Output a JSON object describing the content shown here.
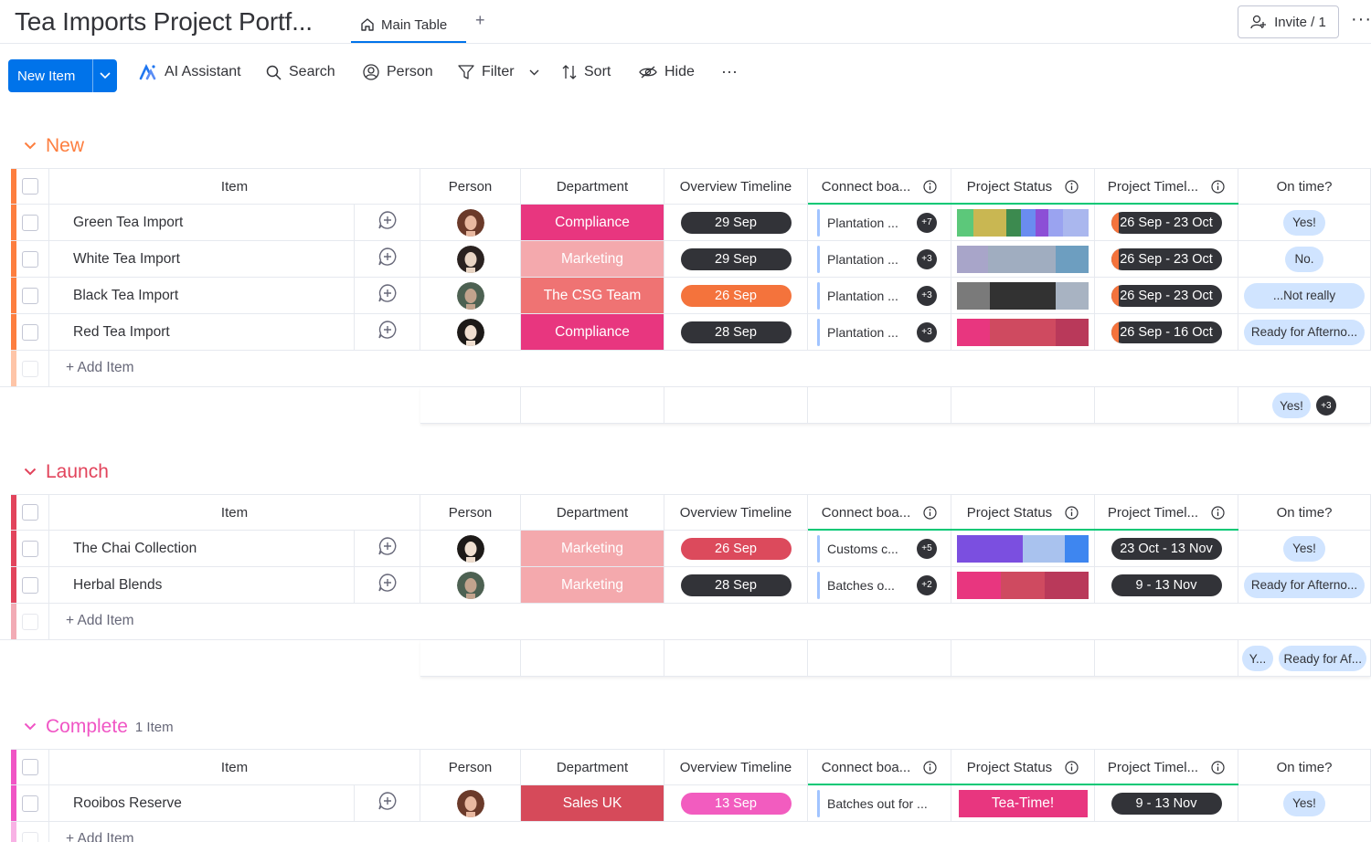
{
  "board": {
    "title": "Tea Imports Project Portf...",
    "view_tab": "Main Table",
    "add_view": "+",
    "invite": "Invite / 1",
    "more": "···"
  },
  "toolbar": {
    "new_item": "New Item",
    "ai": "AI Assistant",
    "search": "Search",
    "person": "Person",
    "filter": "Filter",
    "sort": "Sort",
    "hide": "Hide",
    "more": "···"
  },
  "columns": {
    "item": "Item",
    "person": "Person",
    "department": "Department",
    "overview": "Overview Timeline",
    "connect": "Connect boa...",
    "status": "Project Status",
    "timeline": "Project Timel...",
    "ontime": "On time?"
  },
  "add_item": "+ Add Item",
  "groups": [
    {
      "title": "New",
      "color": "#fd7e3f",
      "count": "",
      "rows": [
        {
          "name": "Green Tea Import",
          "dept": "Compliance",
          "dept_color": "#e8367f",
          "overview": "29 Sep",
          "overview_color": "#323338",
          "connect": "Plantation ...",
          "connect_badge": "+7",
          "timeline": "26 Sep - 23 Oct",
          "ontime": "Yes!"
        },
        {
          "name": "White Tea Import",
          "dept": "Marketing",
          "dept_color": "#f4a9ad",
          "overview": "29 Sep",
          "overview_color": "#323338",
          "connect": "Plantation ...",
          "connect_badge": "+3",
          "timeline": "26 Sep - 23 Oct",
          "ontime": "No."
        },
        {
          "name": "Black Tea Import",
          "dept": "The CSG Team",
          "dept_color": "#ef7373",
          "overview": "26 Sep",
          "overview_color": "#f4733c",
          "connect": "Plantation ...",
          "connect_badge": "+3",
          "timeline": "26 Sep - 23 Oct",
          "ontime": "...Not really"
        },
        {
          "name": "Red Tea Import",
          "dept": "Compliance",
          "dept_color": "#e8367f",
          "overview": "28 Sep",
          "overview_color": "#323338",
          "connect": "Plantation ...",
          "connect_badge": "+3",
          "timeline": "26 Sep - 16 Oct",
          "ontime": "Ready for Afterno..."
        }
      ],
      "summary": {
        "ontime_1": "Yes!",
        "ontime_badge": "+3"
      }
    },
    {
      "title": "Launch",
      "color": "#e2445c",
      "count": "",
      "rows": [
        {
          "name": "The Chai Collection",
          "dept": "Marketing",
          "dept_color": "#f4a9ad",
          "overview": "26 Sep",
          "overview_color": "#dc4a5c",
          "connect": "Customs c...",
          "connect_badge": "+5",
          "timeline": "23 Oct - 13 Nov",
          "ontime": "Yes!"
        },
        {
          "name": "Herbal Blends",
          "dept": "Marketing",
          "dept_color": "#f4a9ad",
          "overview": "28 Sep",
          "overview_color": "#323338",
          "connect": "Batches o...",
          "connect_badge": "+2",
          "timeline": "9 - 13 Nov",
          "ontime": "Ready for Afterno..."
        }
      ],
      "summary": {
        "ontime_1": "Y...",
        "ontime_2": "Ready for Af..."
      }
    },
    {
      "title": "Complete",
      "color": "#f055c5",
      "count": "1 Item",
      "rows": [
        {
          "name": "Rooibos Reserve",
          "dept": "Sales UK",
          "dept_color": "#d64a5a",
          "overview": "13 Sep",
          "overview_color": "#f25cbf",
          "connect": "Batches out for ...",
          "connect_badge": "",
          "timeline": "9 - 13 Nov",
          "ontime": "Yes!",
          "status_label": "Tea-Time!"
        }
      ]
    }
  ],
  "colors": {
    "accent": "#0073ea",
    "border": "#e6e9ef",
    "ontime_bg": "#d0e4ff"
  }
}
